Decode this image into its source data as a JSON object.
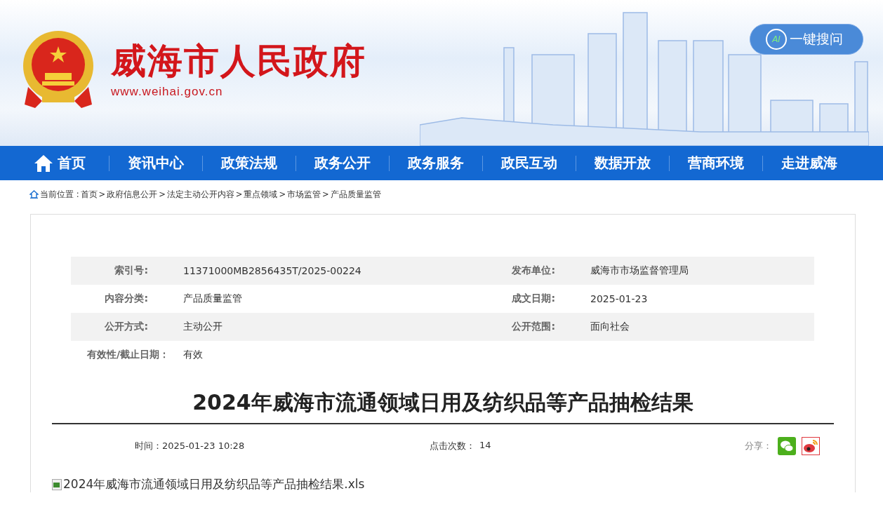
{
  "header": {
    "title": "威海市人民政府",
    "url": "www.weihai.gov.cn",
    "ai_search": {
      "badge": "AI",
      "label": "一键搜问"
    }
  },
  "nav": [
    {
      "label": "首页",
      "kind": "home"
    },
    {
      "label": "资讯中心",
      "kind": "plain"
    },
    {
      "label": "政策法规",
      "kind": "plain"
    },
    {
      "label": "政务公开",
      "kind": "plain"
    },
    {
      "label": "政务服务",
      "kind": "plain"
    },
    {
      "label": "政民互动",
      "kind": "plain"
    },
    {
      "label": "数据开放",
      "kind": "plain"
    },
    {
      "label": "营商环境",
      "kind": "plain"
    },
    {
      "label": "走进威海",
      "kind": "plain"
    }
  ],
  "breadcrumb": {
    "label": "当前位置 :",
    "items": [
      "首页",
      "政府信息公开",
      "法定主动公开内容",
      "重点领域",
      "市场监管",
      "产品质量监管"
    ],
    "separator": ">"
  },
  "meta": [
    {
      "fields": [
        {
          "label": "索引号:",
          "value": "11371000MB2856435T/2025-00224"
        },
        {
          "label": "发布单位:",
          "value": "威海市市场监督管理局"
        }
      ]
    },
    {
      "fields": [
        {
          "label": "内容分类:",
          "value": "产品质量监管"
        },
        {
          "label": "成文日期:",
          "value": "2025-01-23"
        }
      ]
    },
    {
      "fields": [
        {
          "label": "公开方式:",
          "value": "主动公开"
        },
        {
          "label": "公开范围:",
          "value": "面向社会"
        }
      ]
    },
    {
      "fields": [
        {
          "label": "有效性/截止日期：",
          "value": "有效"
        }
      ]
    }
  ],
  "article": {
    "title": "2024年威海市流通领域日用及纺织品等产品抽检结果",
    "time": "时间：2025-01-23 10:28",
    "clicks_label": "点击次数：",
    "clicks": "14",
    "share_label": "分享：",
    "attachment": "2024年威海市流通领域日用及纺织品等产品抽检结果.xls"
  }
}
